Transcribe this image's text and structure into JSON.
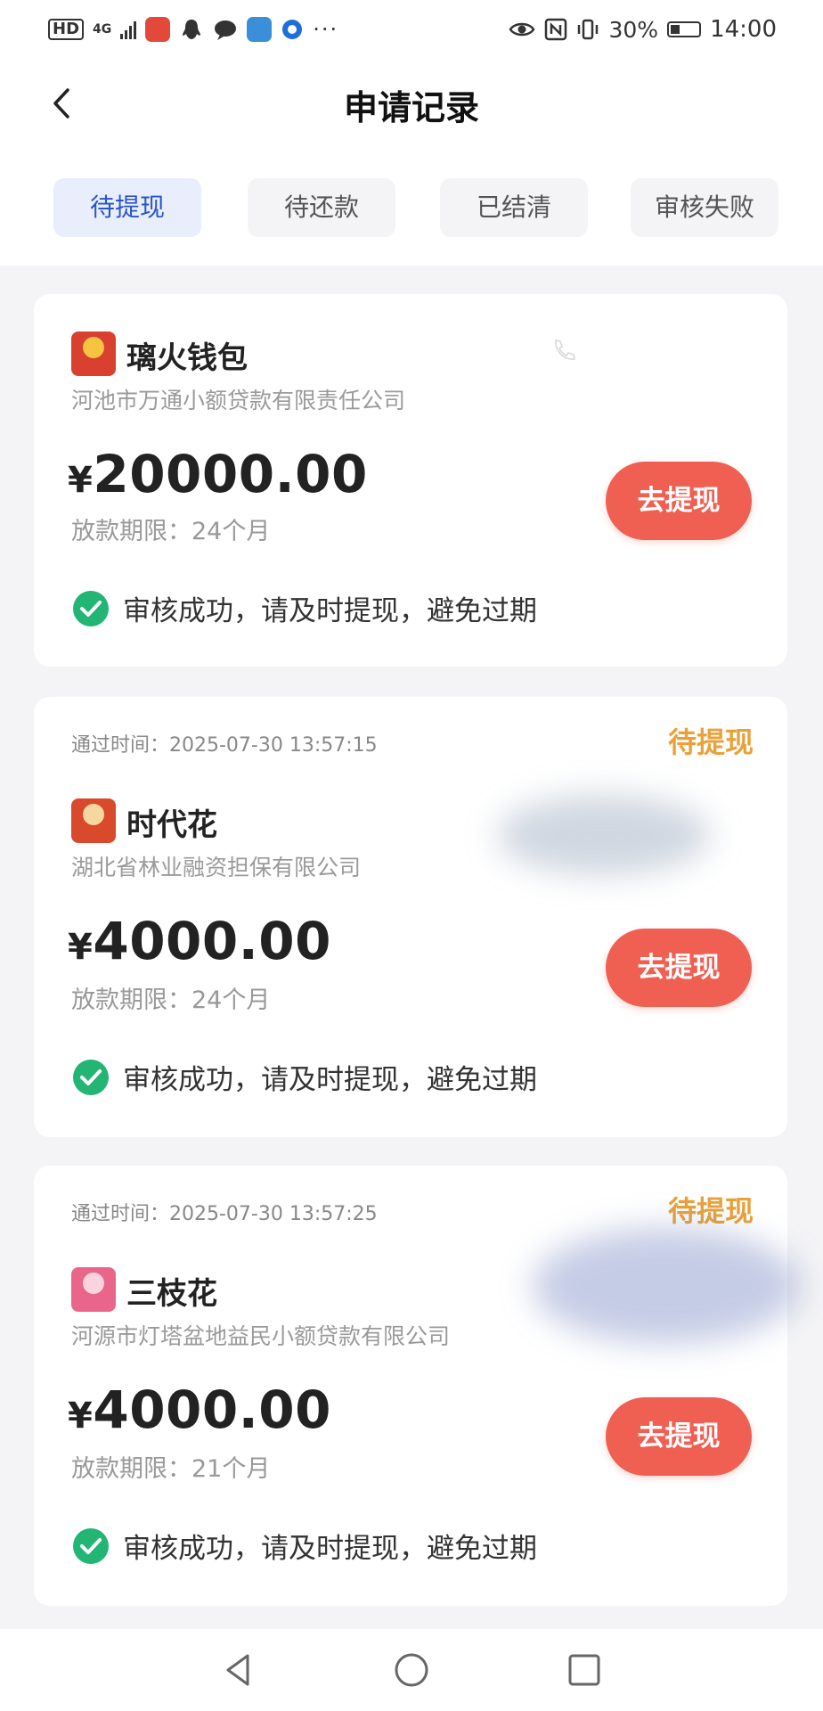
{
  "status_bar": {
    "left_hd": "HD",
    "left_network": "4G",
    "battery": "30%",
    "time": "14:00",
    "more": "···"
  },
  "header": {
    "title": "申请记录",
    "back_icon": "chevron-left-icon"
  },
  "tabs": [
    {
      "label": "待提现",
      "active": true
    },
    {
      "label": "待还款",
      "active": false
    },
    {
      "label": "已结清",
      "active": false
    },
    {
      "label": "审核失败",
      "active": false
    }
  ],
  "cards": [
    {
      "approval_time": "",
      "status_tag": "",
      "app_name": "璃火钱包",
      "logo_text": "璃火钱包",
      "logo_color": "#d8402f",
      "company": "河池市万通小额贷款有限责任公司",
      "currency": "¥",
      "amount": "20000.00",
      "term": "放款期限：24个月",
      "button_label": "去提现",
      "status_text": "审核成功，请及时提现，避免过期"
    },
    {
      "approval_time": "通过时间：2025-07-30 13:57:15",
      "status_tag": "待提现",
      "app_name": "时代花",
      "logo_text": "时代花",
      "logo_color": "#d9492c",
      "company": "湖北省林业融资担保有限公司",
      "currency": "¥",
      "amount": "4000.00",
      "term": "放款期限：24个月",
      "button_label": "去提现",
      "status_text": "审核成功，请及时提现，避免过期"
    },
    {
      "approval_time": "通过时间：2025-07-30 13:57:25",
      "status_tag": "待提现",
      "app_name": "三枝花",
      "logo_text": "三枝花",
      "logo_color": "#e9668a",
      "company": "河源市灯塔盆地益民小额贷款有限公司",
      "currency": "¥",
      "amount": "4000.00",
      "term": "放款期限：21个月",
      "button_label": "去提现",
      "status_text": "审核成功，请及时提现，避免过期"
    }
  ],
  "colors": {
    "accent_blue": "#2a55c9",
    "tab_active_bg": "#e8eefc",
    "button_red": "#ef5f52",
    "status_orange": "#e9a23b",
    "check_green": "#22b573"
  },
  "nav": {
    "back": "nav-back-icon",
    "home": "nav-home-icon",
    "recents": "nav-recents-icon"
  }
}
